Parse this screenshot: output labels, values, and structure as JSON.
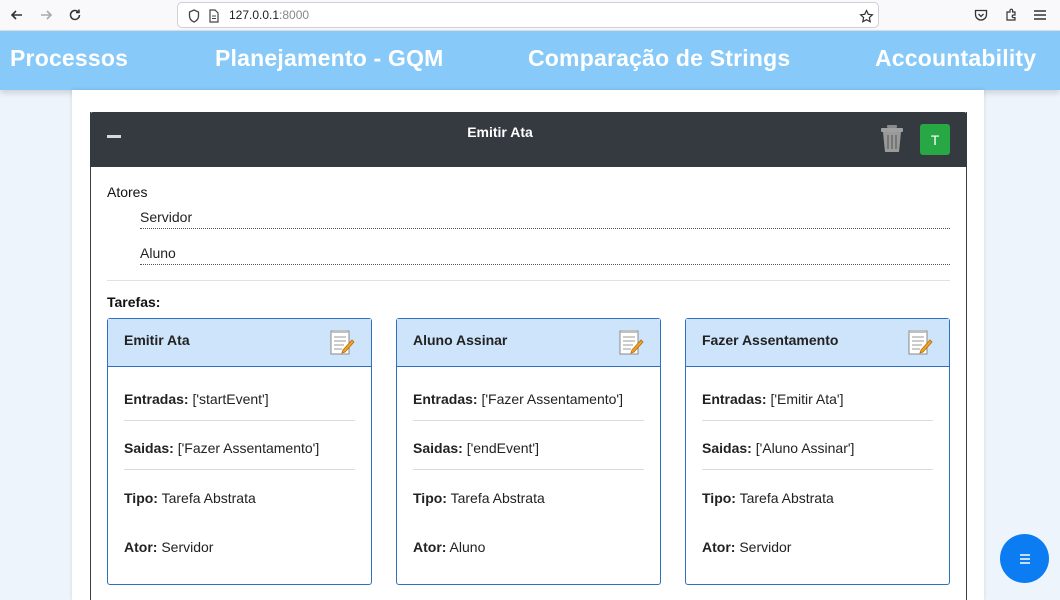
{
  "browser": {
    "url_host": "127.0.0.1",
    "url_port": ":8000"
  },
  "nav": {
    "items": [
      "Processos",
      "Planejamento - GQM",
      "Comparação de Strings",
      "Accountability"
    ]
  },
  "card": {
    "title": "Emitir Ata",
    "t_button": "T",
    "actors_label": "Atores",
    "actors": [
      "Servidor",
      "Aluno"
    ],
    "tasks_label": "Tarefas:"
  },
  "tasks": [
    {
      "title": "Emitir Ata",
      "entradas_label": "Entradas:",
      "entradas": " ['startEvent']",
      "saidas_label": "Saidas:",
      "saidas": " ['Fazer Assentamento']",
      "tipo_label": "Tipo:",
      "tipo": " Tarefa Abstrata",
      "ator_label": "Ator:",
      "ator": " Servidor"
    },
    {
      "title": "Aluno Assinar",
      "entradas_label": "Entradas:",
      "entradas": " ['Fazer Assentamento']",
      "saidas_label": "Saidas:",
      "saidas": " ['endEvent']",
      "tipo_label": "Tipo:",
      "tipo": " Tarefa Abstrata",
      "ator_label": "Ator:",
      "ator": " Aluno"
    },
    {
      "title": "Fazer Assentamento",
      "entradas_label": "Entradas:",
      "entradas": " ['Emitir Ata']",
      "saidas_label": "Saidas:",
      "saidas": " ['Aluno Assinar']",
      "tipo_label": "Tipo:",
      "tipo": " Tarefa Abstrata",
      "ator_label": "Ator:",
      "ator": " Servidor"
    }
  ],
  "fab": {
    "icon": "menu-icon"
  },
  "colors": {
    "nav_bg": "#87c9f8",
    "card_header": "#343a40",
    "t_button": "#28a745",
    "task_header": "#cde4fb",
    "task_border": "#2f6fbf",
    "fab": "#0b7cf2"
  }
}
